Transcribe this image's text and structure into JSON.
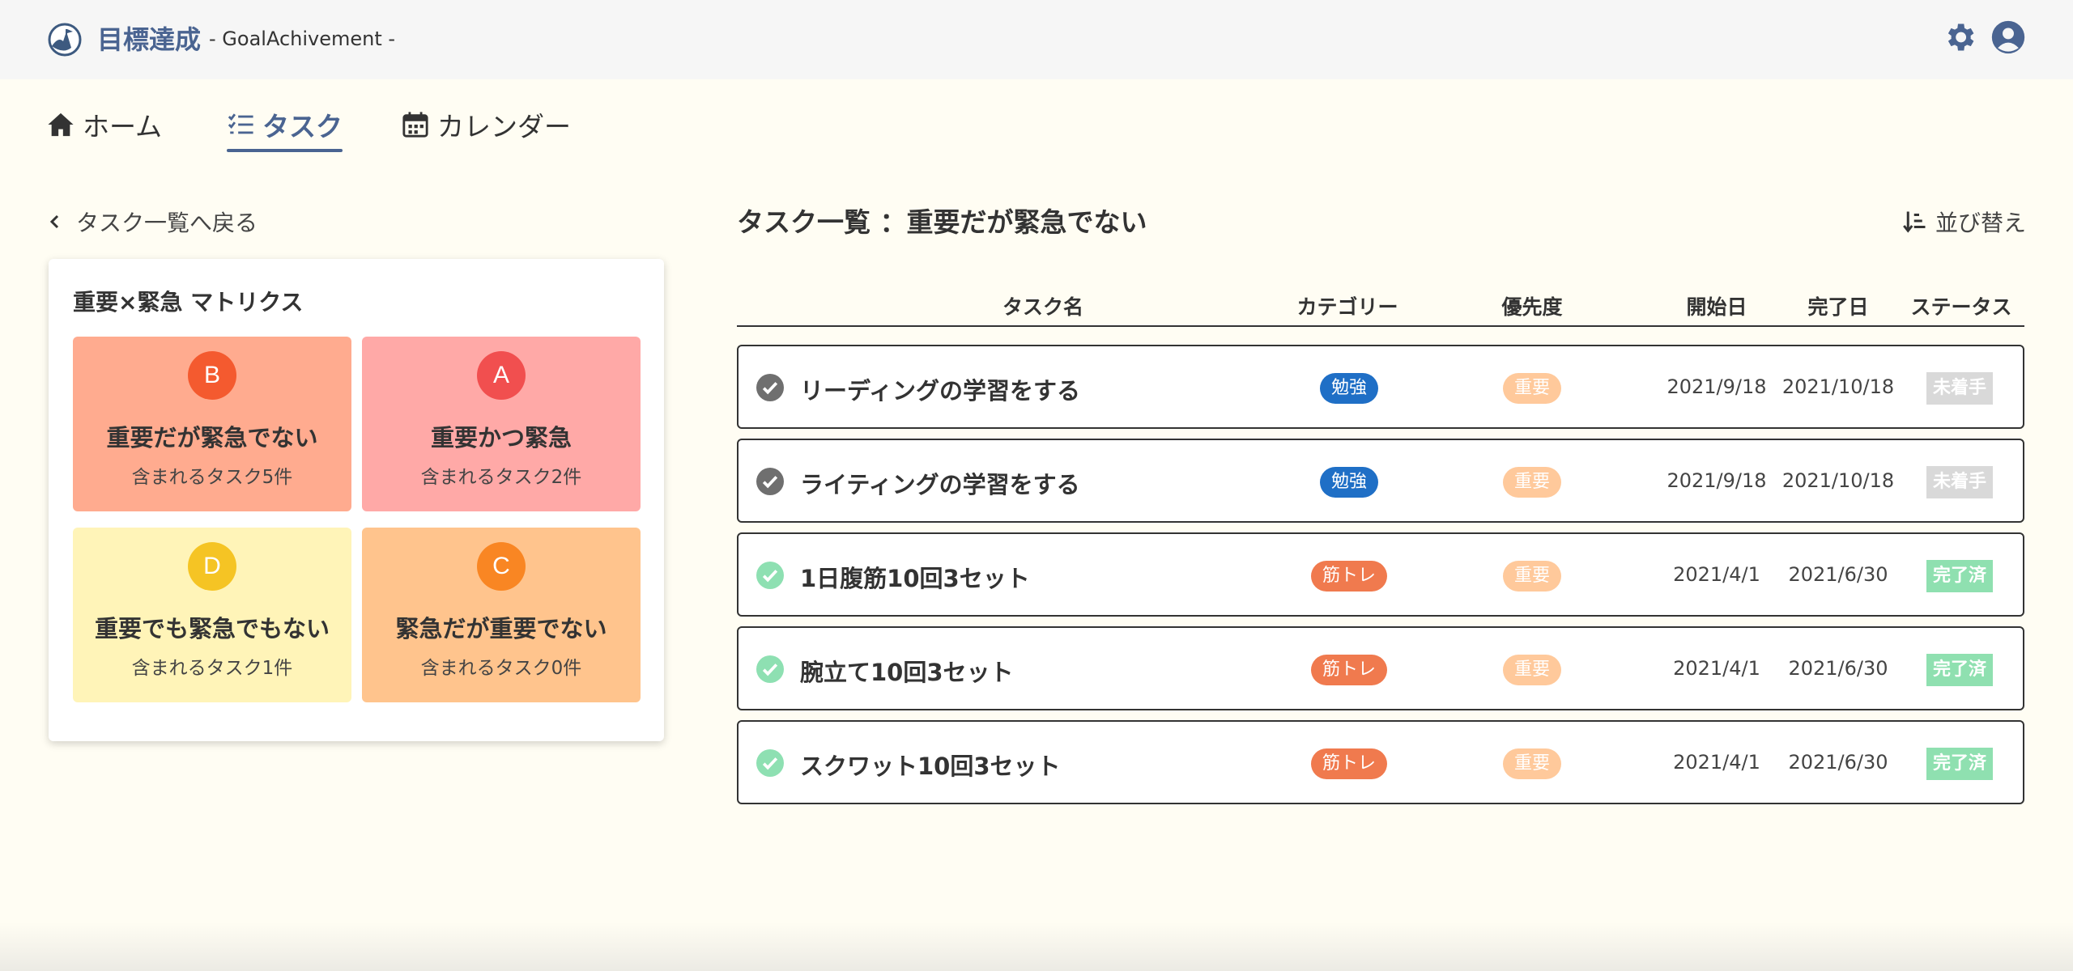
{
  "header": {
    "title": "目標達成",
    "subtitle": "- GoalAchivement -"
  },
  "nav": {
    "tabs": [
      {
        "label": "ホーム",
        "icon": "home-icon"
      },
      {
        "label": "タスク",
        "icon": "task-list-icon",
        "active": true
      },
      {
        "label": "カレンダー",
        "icon": "calendar-icon"
      }
    ]
  },
  "back_label": "タスク一覧へ戻る",
  "matrix": {
    "title": "重要×緊急 マトリクス",
    "quadrants": [
      {
        "badge": "B",
        "name": "重要だが緊急でない",
        "count_text": "含まれるタスク5件"
      },
      {
        "badge": "A",
        "name": "重要かつ緊急",
        "count_text": "含まれるタスク2件"
      },
      {
        "badge": "D",
        "name": "重要でも緊急でもない",
        "count_text": "含まれるタスク1件"
      },
      {
        "badge": "C",
        "name": "緊急だが重要でない",
        "count_text": "含まれるタスク0件"
      }
    ]
  },
  "list": {
    "title": "タスク一覧 ：重要だが緊急でない",
    "sort_label": "並び替え",
    "columns": {
      "name": "タスク名",
      "category": "カテゴリー",
      "priority": "優先度",
      "start": "開始日",
      "end": "完了日",
      "status": "ステータス"
    },
    "rows": [
      {
        "name": "リーディングの学習をする",
        "category": "勉強",
        "priority": "重要",
        "start": "2021/9/18",
        "end": "2021/10/18",
        "status": "未着手"
      },
      {
        "name": "ライティングの学習をする",
        "category": "勉強",
        "priority": "重要",
        "start": "2021/9/18",
        "end": "2021/10/18",
        "status": "未着手"
      },
      {
        "name": "1日腹筋10回3セット",
        "category": "筋トレ",
        "priority": "重要",
        "start": "2021/4/1",
        "end": "2021/6/30",
        "status": "完了済"
      },
      {
        "name": "腕立て10回3セット",
        "category": "筋トレ",
        "priority": "重要",
        "start": "2021/4/1",
        "end": "2021/6/30",
        "status": "完了済"
      },
      {
        "name": "スクワット10回3セット",
        "category": "筋トレ",
        "priority": "重要",
        "start": "2021/4/1",
        "end": "2021/6/30",
        "status": "完了済"
      }
    ]
  },
  "colors": {
    "accent": "#4a6491",
    "background": "#fffdf3",
    "category_study": "#1f6fc6",
    "category_training": "#f07a4e",
    "priority_important": "#ffc99b",
    "status_not_started": "#d9d9d9",
    "status_done": "#8fe0b0",
    "check_not_started": "#6f6f6f",
    "check_done": "#8ee0b2"
  }
}
